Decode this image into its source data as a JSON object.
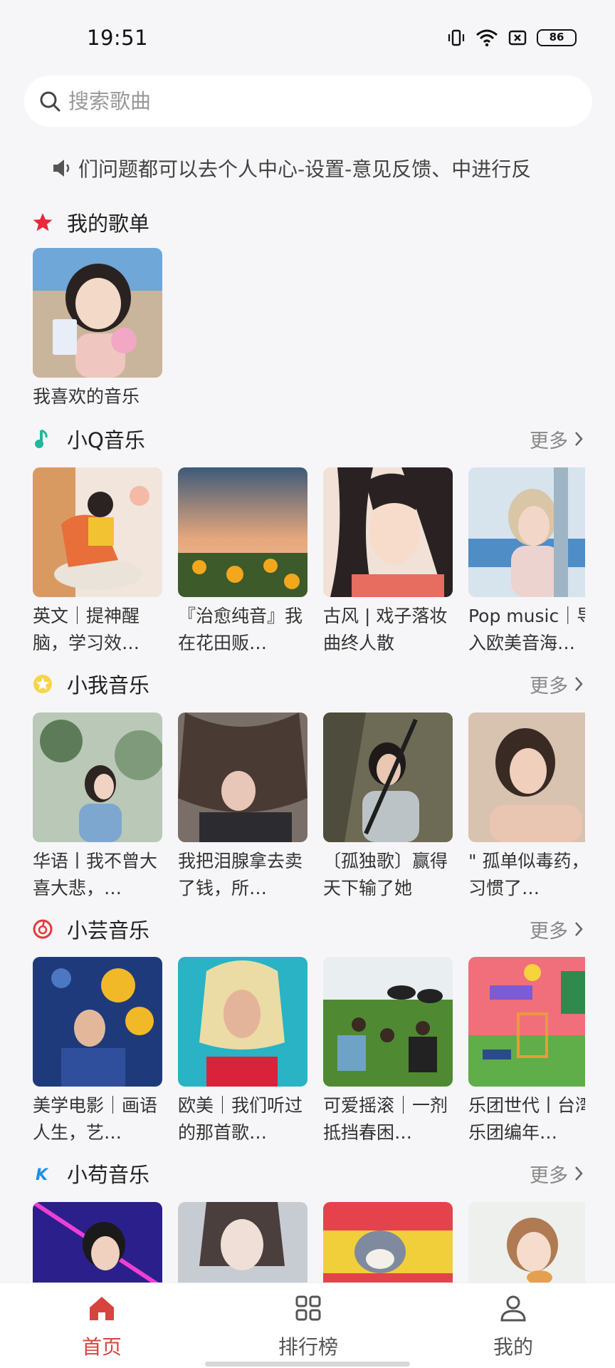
{
  "status": {
    "time": "19:51",
    "battery": "86"
  },
  "search": {
    "placeholder": "搜索歌曲",
    "value": ""
  },
  "notice": {
    "text": "们问题都可以去个人中心-设置-意见反馈、中进行反"
  },
  "my_playlists": {
    "title": "我的歌单",
    "items": [
      {
        "title": "我喜欢的音乐"
      }
    ]
  },
  "sections": [
    {
      "title": "小Q音乐",
      "more": "更多",
      "items": [
        {
          "title": "英文｜提神醒脑，学习效…"
        },
        {
          "title": "『治愈纯音』我在花田贩…"
        },
        {
          "title": "古风 | 戏子落妆曲终人散"
        },
        {
          "title": "Pop music｜导入欧美音海…"
        }
      ]
    },
    {
      "title": "小我音乐",
      "more": "更多",
      "items": [
        {
          "title": "华语丨我不曾大喜大悲，…"
        },
        {
          "title": "我把泪腺拿去卖了钱，所…"
        },
        {
          "title": "〔孤独歌〕赢得天下输了她"
        },
        {
          "title": "\" 孤单似毒药，习惯了…"
        }
      ]
    },
    {
      "title": "小芸音乐",
      "more": "更多",
      "items": [
        {
          "title": "美学电影｜画语人生，艺…"
        },
        {
          "title": "欧美｜我们听过的那首歌…"
        },
        {
          "title": "可爱摇滚｜一剂抵挡春困…"
        },
        {
          "title": "乐团世代丨台湾乐团编年…"
        }
      ]
    },
    {
      "title": "小苟音乐",
      "more": "更多",
      "items": [
        {
          "title": ""
        },
        {
          "title": ""
        },
        {
          "title": ""
        },
        {
          "title": ""
        }
      ]
    }
  ],
  "nav": [
    {
      "label": "首页",
      "icon": "home-icon",
      "active": true
    },
    {
      "label": "排行榜",
      "icon": "grid-icon",
      "active": false
    },
    {
      "label": "我的",
      "icon": "user-icon",
      "active": false
    }
  ],
  "colors": {
    "accent": "#d7443f",
    "background": "#f6f6f8"
  }
}
